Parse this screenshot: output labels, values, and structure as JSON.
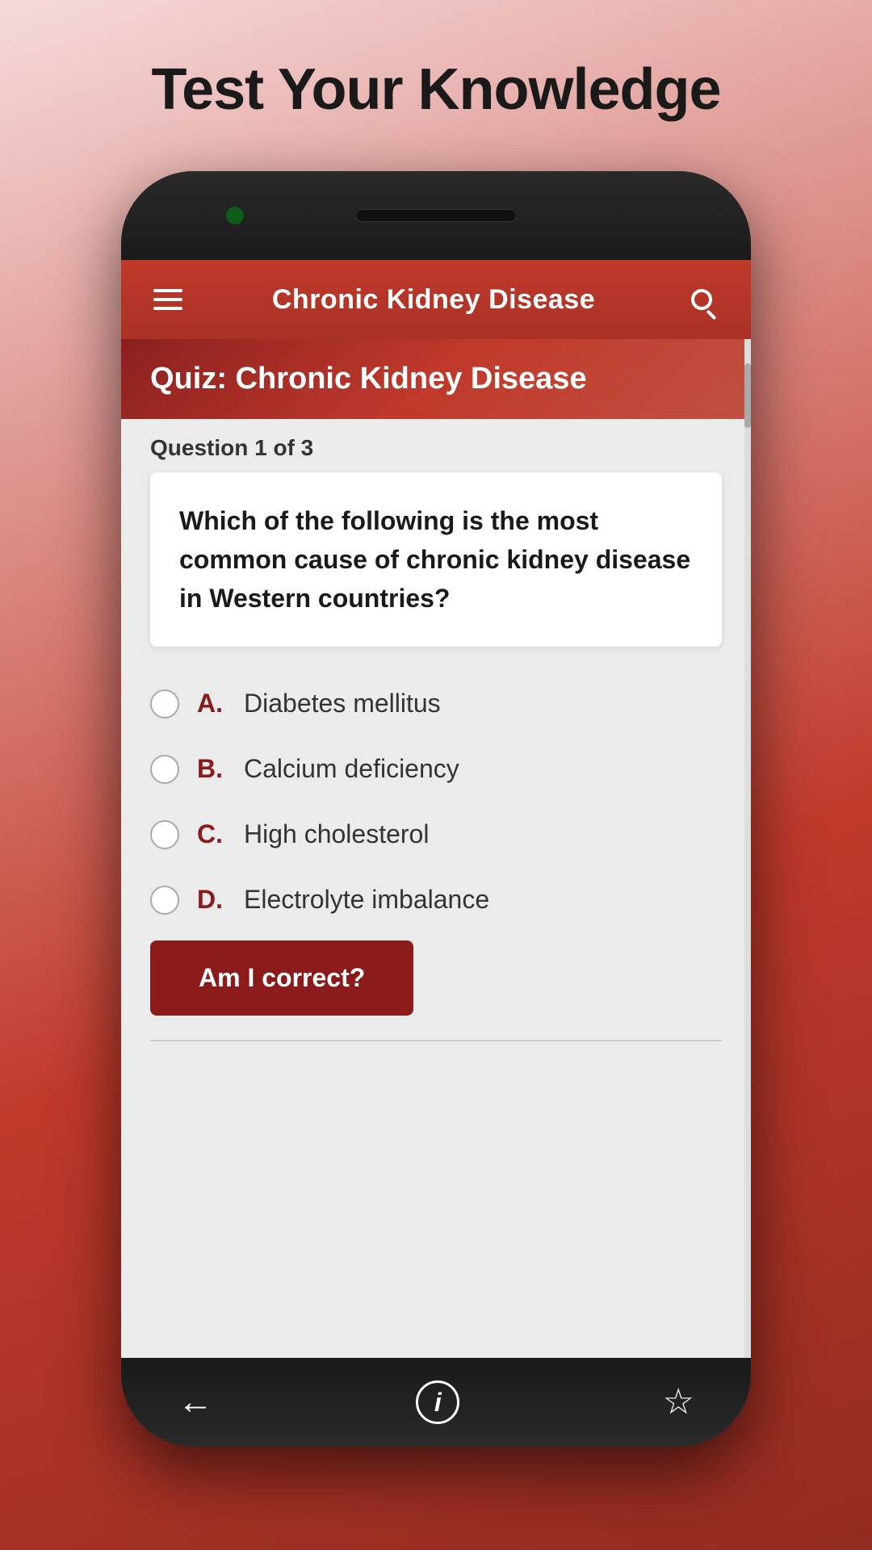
{
  "page": {
    "title": "Test Your Knowledge"
  },
  "header": {
    "title": "Chronic Kidney Disease",
    "menu_label": "menu",
    "search_label": "search"
  },
  "quiz": {
    "banner_title": "Quiz: Chronic Kidney Disease",
    "question_counter": "Question 1 of 3",
    "question_text": "Which of the following is the most common cause of chronic kidney disease in Western countries?",
    "options": [
      {
        "letter": "A.",
        "text": "Diabetes mellitus"
      },
      {
        "letter": "B.",
        "text": "Calcium deficiency"
      },
      {
        "letter": "C.",
        "text": "High cholesterol"
      },
      {
        "letter": "D.",
        "text": "Electrolyte imbalance"
      }
    ],
    "check_button_label": "Am I correct?"
  },
  "nav": {
    "back_label": "back",
    "info_label": "i",
    "star_label": "star"
  }
}
